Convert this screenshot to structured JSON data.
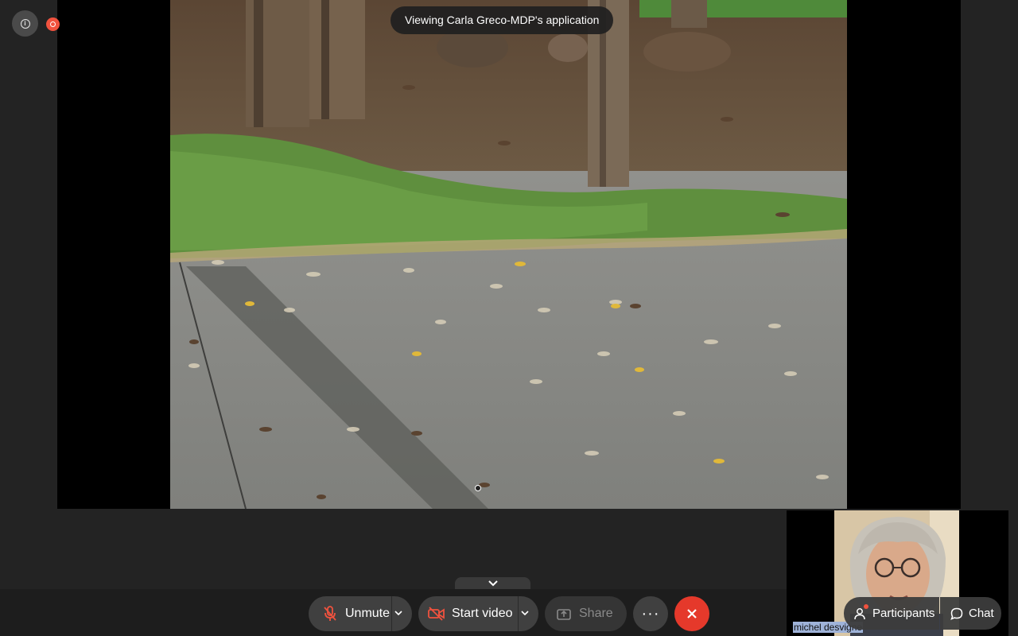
{
  "banner": {
    "text": "Viewing Carla Greco-MDP's application"
  },
  "self_view": {
    "participant_name": "michel desvigne"
  },
  "toolbar": {
    "unmute_label": "Unmute",
    "start_video_label": "Start video",
    "share_label": "Share",
    "more_label": "···"
  },
  "side_buttons": {
    "participants_label": "Participants",
    "chat_label": "Chat"
  },
  "colors": {
    "leave_red": "#e5392b",
    "recording_red": "#f0523e",
    "toolbar_bg": "#1d1d1d",
    "button_bg": "#404040"
  },
  "icons": {
    "info": "info-icon",
    "recording": "recording-icon",
    "microphone_muted": "microphone-muted-icon",
    "video_off": "video-off-icon",
    "share": "share-icon",
    "more": "more-icon",
    "leave": "close-icon",
    "participants": "participants-icon",
    "chat": "chat-icon",
    "collapse": "chevron-down-icon"
  }
}
